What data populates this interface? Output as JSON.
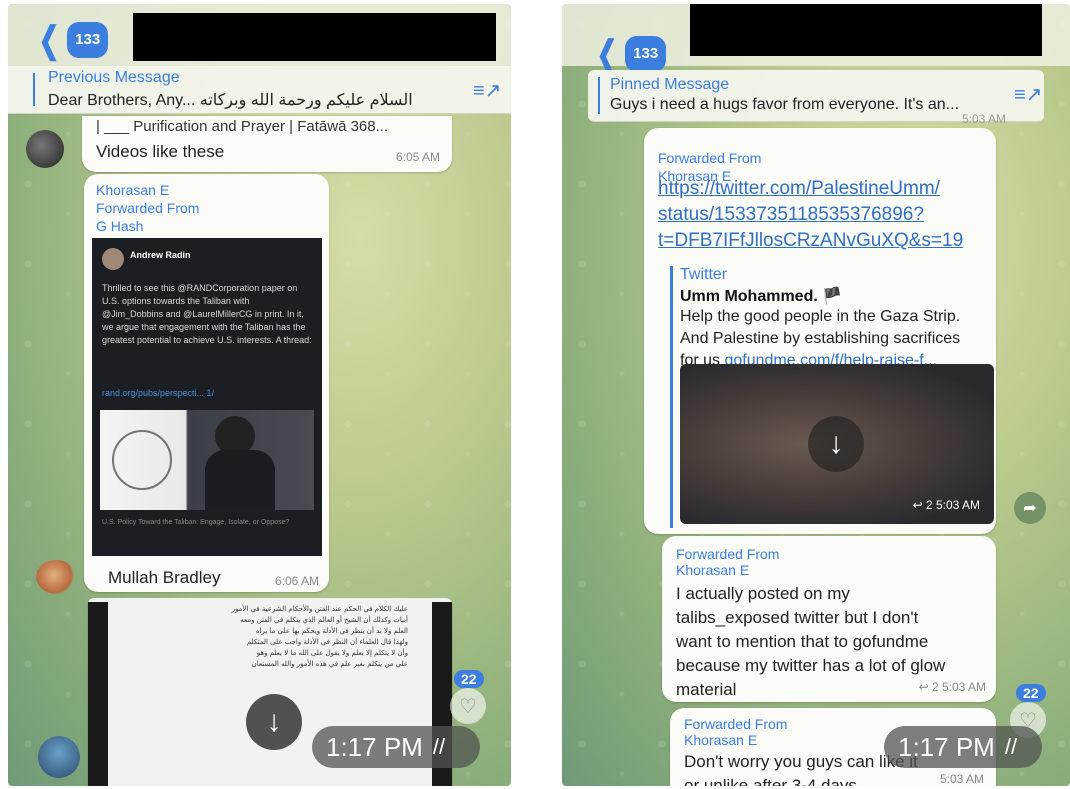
{
  "left": {
    "unread_count": "133",
    "pinned_label": "Previous Message",
    "pinned_text": "Dear Brothers,  Any... السلام عليكم ورحمة الله وبركاته",
    "msg1": {
      "quote_line": "| ___ Purification and Prayer | Fatāwā 368...",
      "text": "Videos like these",
      "time": "6:05 AM"
    },
    "msg2": {
      "sender": "Khorasan E",
      "forwarded_label": "Forwarded From",
      "forwarded_name": "G Hash",
      "tweet_author": "Andrew Radin",
      "tweet_text": "Thrilled to see this @RANDCorporation paper on U.S. options towards the Taliban with @Jim_Dobbins and @LaurelMillerCG in print. In it, we argue that engagement with the Taliban has the greatest potential to achieve U.S. interests. A thread:",
      "tweet_link": "rand.org/pubs/perspecti... 1/",
      "tweet_caption": "U.S. Policy Toward the Taliban: Engage, Isolate, or Oppose?",
      "text": "Mullah Bradley",
      "time": "6:06 AM"
    },
    "doc_lines": [
      "عليك الكلام في الحكم عند الفتن والأحكام الشرعية في الأمور",
      "أبيات وكذلك أن الشيخ أو العالم الذي يتكلم في الفتن ومعه",
      "العلم ولا بد أن ينظر في الأدلة ويحكم بها على ما يراه",
      "ولهذا قال العلماء أن النظر في الأدلة واجب على المتكلم",
      "وأن لا يتكلم إلا بعلم ولا يقول على الله ما لا يعلم وهو",
      "على من يتكلم بغير علم في هذه الأمور والله المستعان"
    ],
    "overlay_time": "1:17 PM",
    "overlay_checks": "//",
    "reaction_count": "22"
  },
  "right": {
    "unread_count": "133",
    "pinned_label": "Pinned Message",
    "pinned_text": "Guys i need a hugs favor from everyone. It's an...",
    "prev_time": "5:03 AM",
    "msg1": {
      "forwarded_label": "Forwarded From",
      "forwarded_name": "Khorasan E",
      "link": "https://twitter.com/PalestineUmm/status/1533735118535376896?t=DFB7IFfJllosCRzANvGuXQ&s=19",
      "link_lines": [
        "https://twitter.com/PalestineUmm/",
        "status/1533735118535376896?",
        "t=DFB7IFfJllosCRzANvGuXQ&s=19"
      ],
      "preview_site": "Twitter",
      "preview_title": "Umm Mohammed. 🏴",
      "preview_text_lines": [
        "Help the good people in the Gaza Strip.",
        "And Palestine by establishing sacrifices",
        "for us"
      ],
      "preview_link": "gofundme.com/f/help-raise-f...",
      "media_meta": "↩ 2  5:03 AM"
    },
    "msg2": {
      "forwarded_label": "Forwarded From",
      "forwarded_name": "Khorasan E",
      "text_lines": [
        "I actually posted on my",
        "talibs_exposed twitter but I don't",
        "want to mention that to gofundme",
        "because my twitter has a lot of glow",
        "material"
      ],
      "meta": "↩ 2  5:03 AM"
    },
    "msg3": {
      "forwarded_label": "Forwarded From",
      "forwarded_name": "Khorasan E",
      "text_lines": [
        "Don't worry you guys can like it",
        "or unlike after 3-4 days"
      ],
      "time": "5:03 AM"
    },
    "overlay_time": "1:17 PM",
    "overlay_checks": "//",
    "reaction_count": "22"
  },
  "colors": {
    "accent": "#3b7ee0",
    "bubble": "#fbfbf8",
    "chat_bg": "#b9c98c"
  },
  "icons": [
    "back-chevron-icon",
    "pin-icon",
    "download-icon",
    "heart-icon",
    "share-icon",
    "reply-icon",
    "double-check-icon"
  ]
}
